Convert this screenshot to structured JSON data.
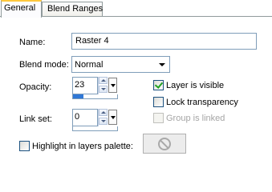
{
  "tabs": {
    "general": "General",
    "blend_ranges": "Blend Ranges"
  },
  "name": {
    "label": "Name:",
    "value": "Raster 4"
  },
  "blend_mode": {
    "label": "Blend mode:",
    "selected": "Normal"
  },
  "opacity": {
    "label": "Opacity:",
    "value": "23",
    "level_percent": 23
  },
  "link_set": {
    "label": "Link set:",
    "value": "0"
  },
  "checkboxes": {
    "layer_visible": {
      "label": "Layer is visible",
      "checked": true
    },
    "lock_transparency": {
      "label": "Lock transparency",
      "checked": false
    },
    "group_linked": {
      "label": "Group is linked",
      "checked": false,
      "enabled": false
    },
    "highlight": {
      "label": "Highlight in layers palette:",
      "checked": false
    }
  },
  "icons": {
    "highlight_color": "no-symbol-icon"
  },
  "colors": {
    "tab_accent": "#ffc83c",
    "field_border": "#7f9db9",
    "bar_fill": "#2f77d6"
  }
}
